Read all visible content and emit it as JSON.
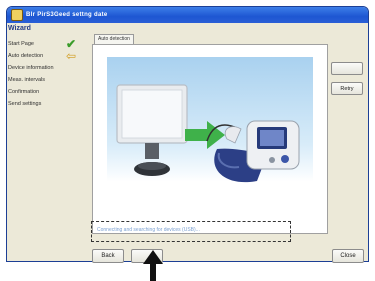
{
  "window": {
    "title": "Blr PirS3Geed settng date"
  },
  "sidebar": {
    "heading": "Wizard",
    "steps": [
      {
        "label": "Start Page",
        "status_icon": "check-icon"
      },
      {
        "label": "Auto detection",
        "status_icon": "arrow-left-icon"
      },
      {
        "label": "Device information"
      },
      {
        "label": "Meas. intervals"
      },
      {
        "label": "Confirmation"
      },
      {
        "label": "Send settings"
      }
    ]
  },
  "main": {
    "tab_label": "Auto detection",
    "status_text": "Connecting and searching for devices (USB)..."
  },
  "buttons": {
    "side_top": "",
    "retry": "Retry",
    "back": "Back",
    "next": "",
    "close": "Close"
  },
  "colors": {
    "titlebar": "#1d56d2",
    "check": "#3a9c2a",
    "arrow": "#d09a1a",
    "sync_arrow": "#3fb14a"
  },
  "illustration": {
    "icons": [
      "monitor-icon",
      "sync-arrow-icon",
      "blood-pressure-monitor-icon"
    ]
  }
}
